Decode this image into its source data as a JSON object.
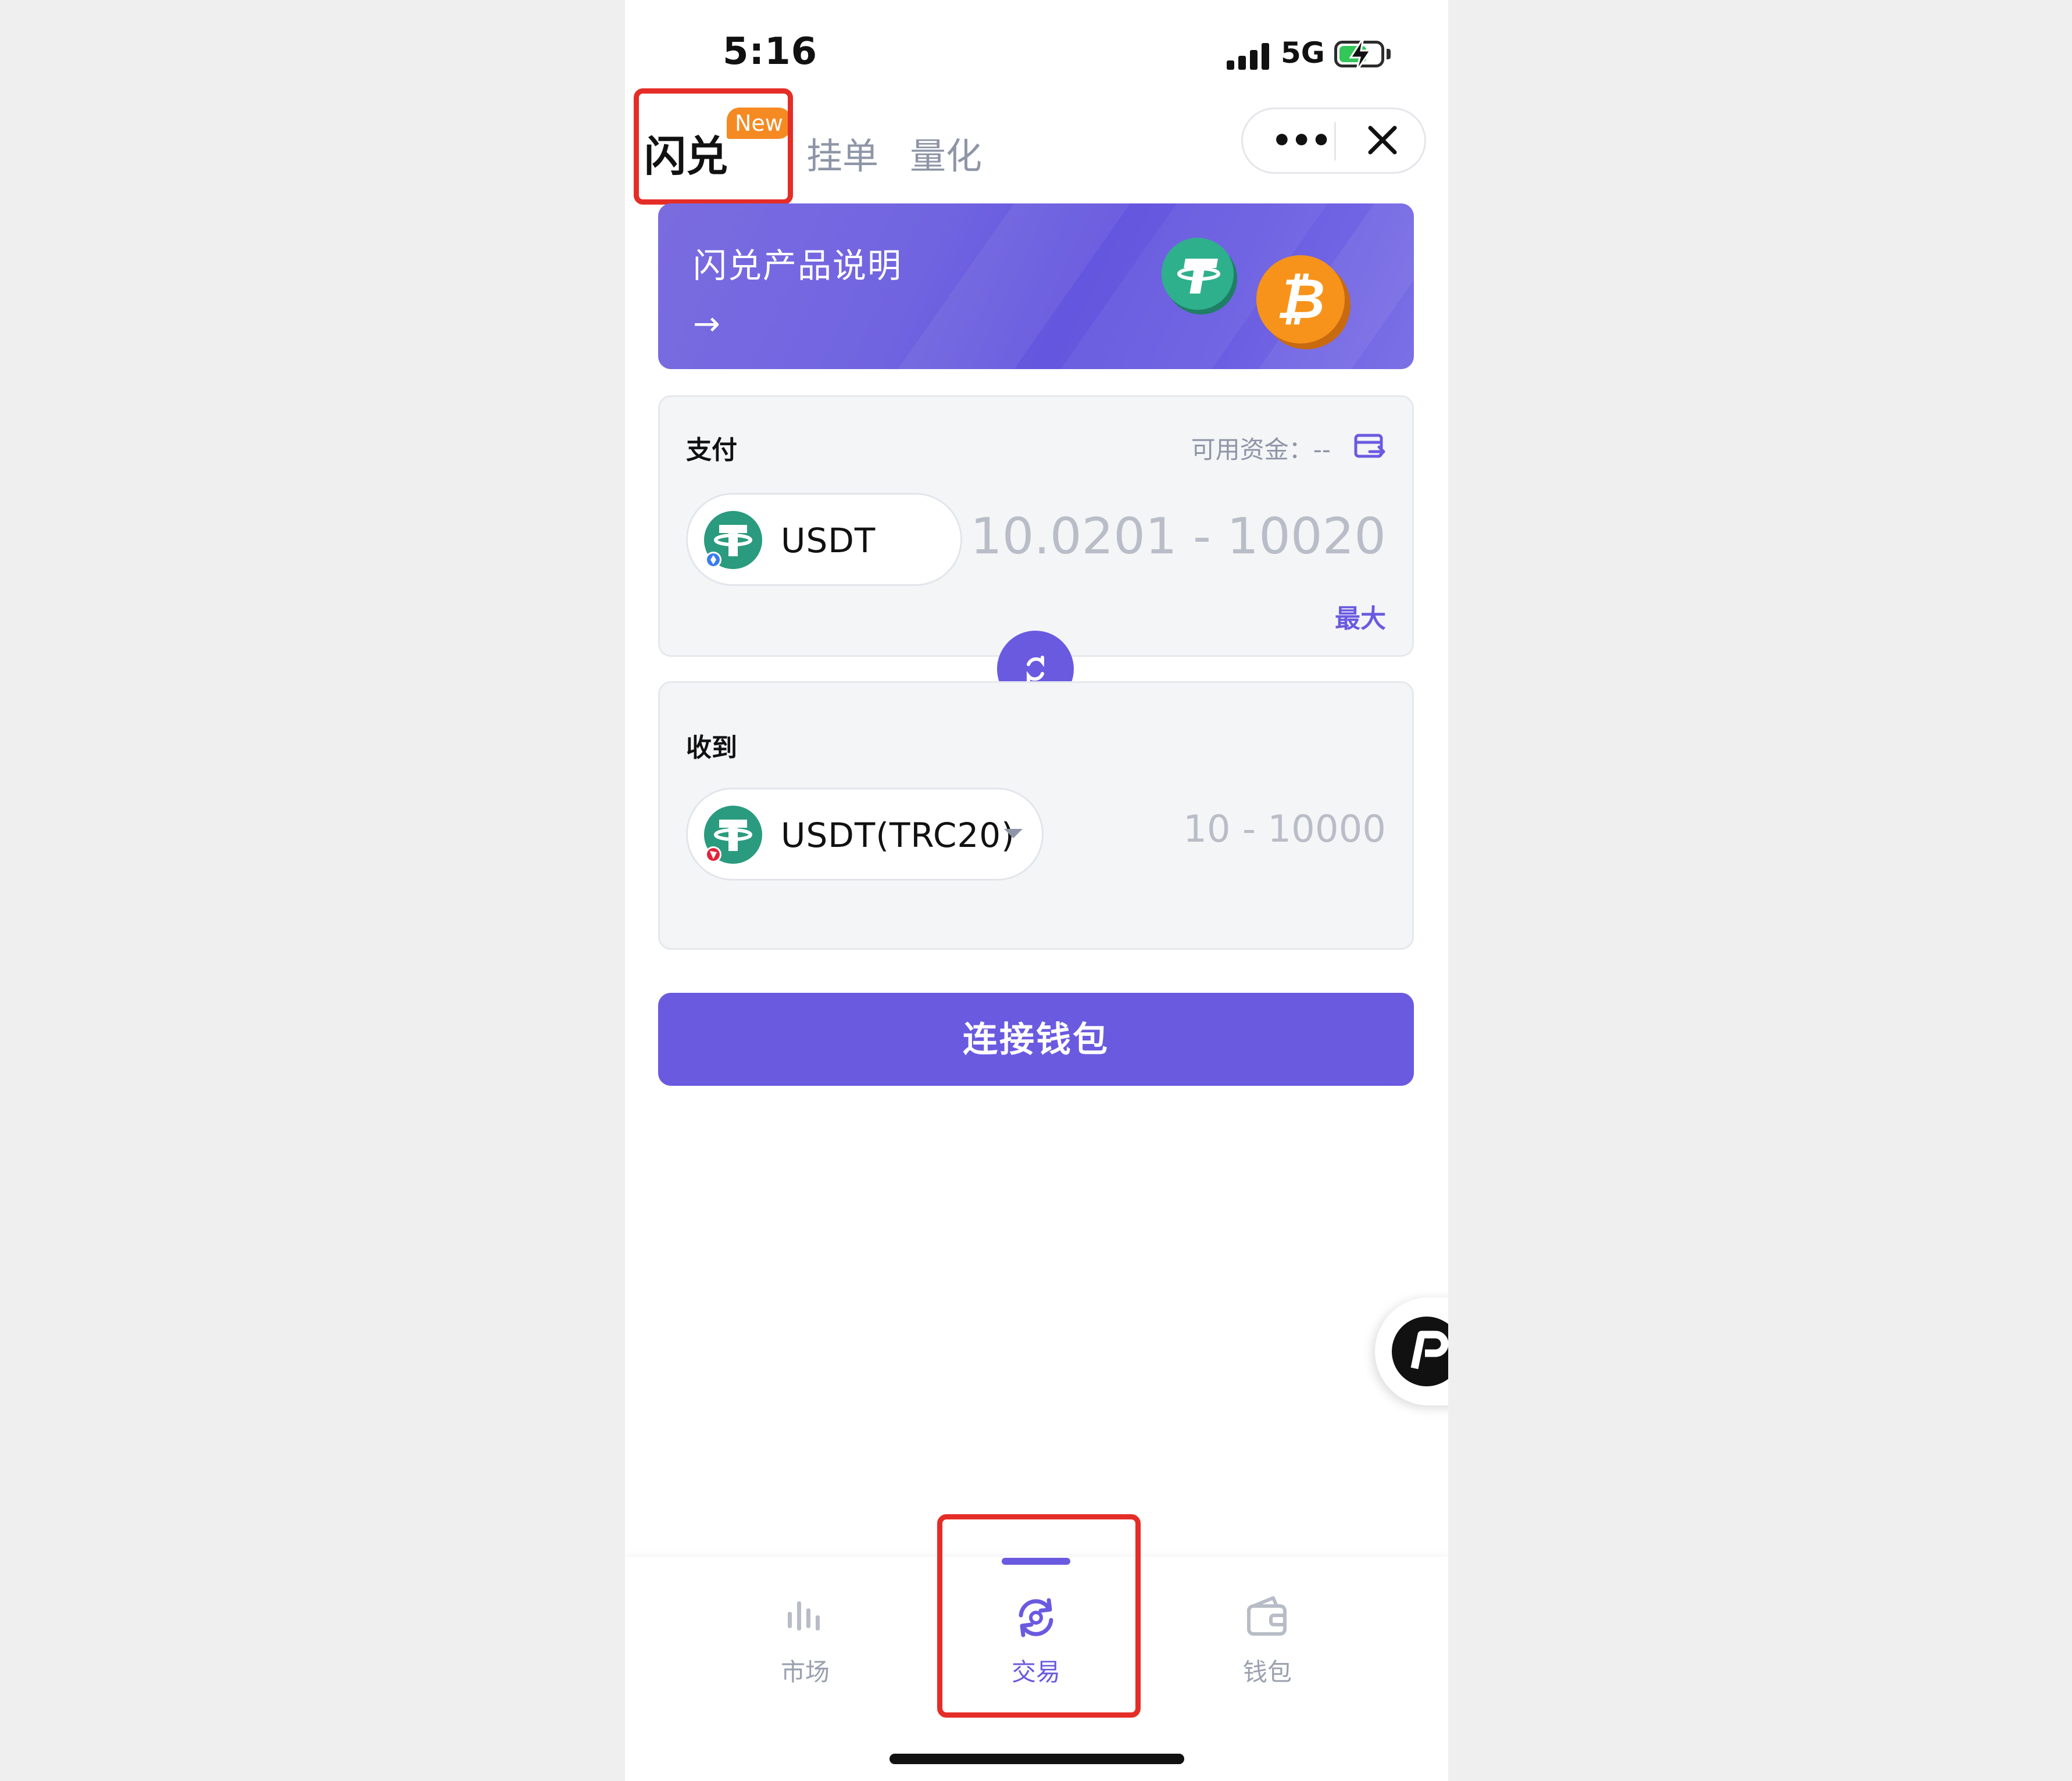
{
  "status_bar": {
    "time": "5:16",
    "network": "5G",
    "battery_charging": true
  },
  "tabs": [
    {
      "label": "闪兑",
      "active": true,
      "badge": "New"
    },
    {
      "label": "挂单",
      "active": false
    },
    {
      "label": "量化",
      "active": false
    }
  ],
  "capsule": {
    "more_icon": "more-dots-icon",
    "close_icon": "close-icon"
  },
  "banner": {
    "title": "闪兑产品说明",
    "arrow": "→",
    "coins": [
      "tether-icon",
      "bitcoin-icon"
    ]
  },
  "pay": {
    "label": "支付",
    "available_label": "可用资金：",
    "available_value": "--",
    "token": "USDT",
    "amount_placeholder": "10.0201 - 10020",
    "max_label": "最大"
  },
  "receive": {
    "label": "收到",
    "token": "USDT(TRC20)",
    "amount_placeholder": "10 - 10000"
  },
  "connect_button": "连接钱包",
  "bottom_nav": [
    {
      "label": "市场",
      "icon": "chart-bars-icon",
      "active": false
    },
    {
      "label": "交易",
      "icon": "trade-swap-icon",
      "active": true
    },
    {
      "label": "钱包",
      "icon": "wallet-icon",
      "active": false
    }
  ],
  "colors": {
    "accent": "#6a5ae0",
    "highlight_box": "#e52d27",
    "badge": "#f58a23",
    "tether": "#2a9b7e",
    "bitcoin": "#f7931a"
  }
}
